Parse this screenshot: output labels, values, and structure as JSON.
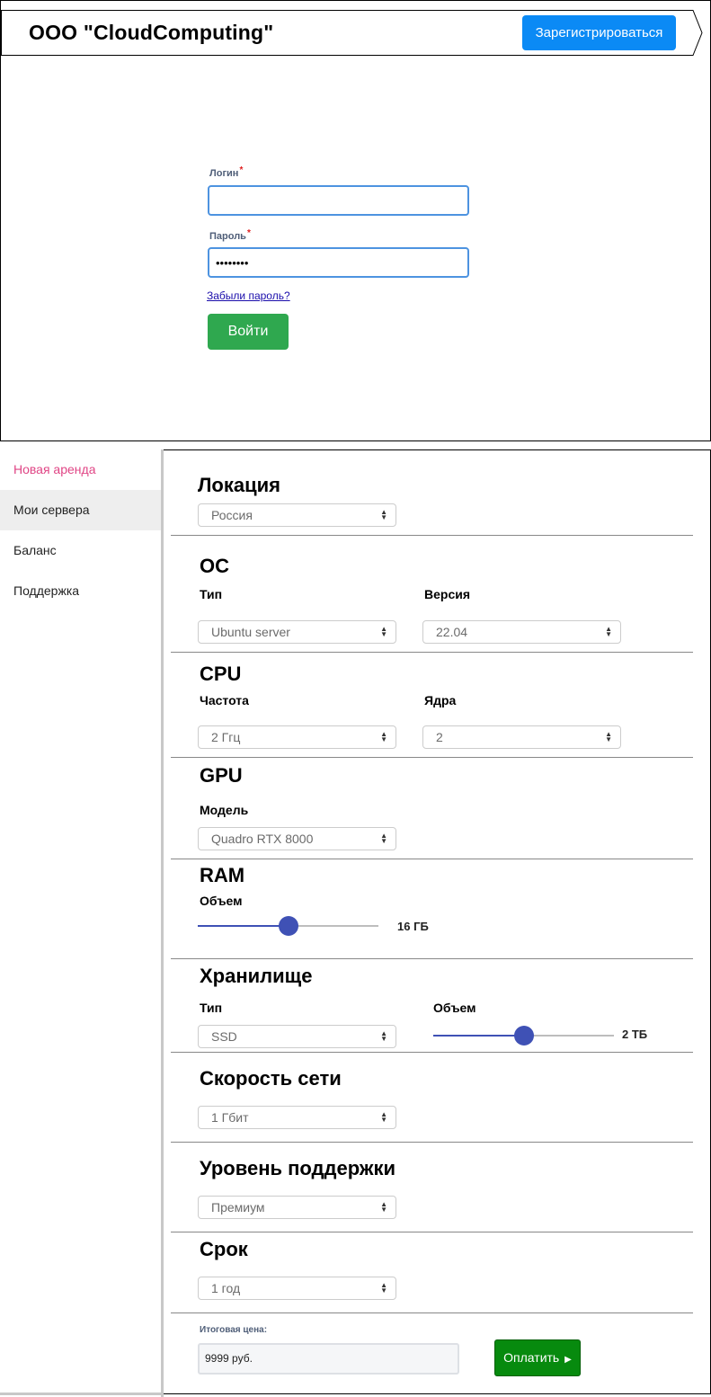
{
  "header": {
    "company": "ООО \"CloudComputing\"",
    "register_label": "Зарегистрироваться"
  },
  "login_form": {
    "login_label": "Логин",
    "login_value": "",
    "password_label": "Пароль",
    "password_value": "12345678",
    "required_mark": "*",
    "forgot_label": "Забыли пароль?",
    "submit_label": "Войти"
  },
  "sidebar": {
    "items": [
      {
        "label": "Новая аренда",
        "state": "active"
      },
      {
        "label": "Мои сервера",
        "state": "hover"
      },
      {
        "label": "Баланс",
        "state": ""
      },
      {
        "label": "Поддержка",
        "state": ""
      }
    ]
  },
  "config": {
    "location": {
      "title": "Локация",
      "value": "Россия"
    },
    "os": {
      "title": "ОС",
      "type_label": "Тип",
      "type_value": "Ubuntu server",
      "version_label": "Версия",
      "version_value": "22.04"
    },
    "cpu": {
      "title": "CPU",
      "freq_label": "Частота",
      "freq_value": "2 Ггц",
      "cores_label": "Ядра",
      "cores_value": "2"
    },
    "gpu": {
      "title": "GPU",
      "model_label": "Модель",
      "model_value": "Quadro RTX 8000"
    },
    "ram": {
      "title": "RAM",
      "volume_label": "Объем",
      "volume_value": "16 ГБ",
      "slider_fraction": 0.5
    },
    "storage": {
      "title": "Хранилище",
      "type_label": "Тип",
      "type_value": "SSD",
      "volume_label": "Объем",
      "volume_value": "2 ТБ",
      "slider_fraction": 0.5
    },
    "network": {
      "title": "Скорость сети",
      "value": "1 Гбит"
    },
    "support": {
      "title": "Уровень поддержки",
      "value": "Премиум"
    },
    "term": {
      "title": "Срок",
      "value": "1 год"
    }
  },
  "total": {
    "label": "Итоговая цена:",
    "value": "9999 руб.",
    "pay_label": "Оплатить"
  },
  "colors": {
    "register_button": "#0b8af5",
    "login_button": "#2fa84f",
    "pay_button": "#078a0e",
    "slider": "#3f51b5",
    "active_nav": "#e04585"
  }
}
